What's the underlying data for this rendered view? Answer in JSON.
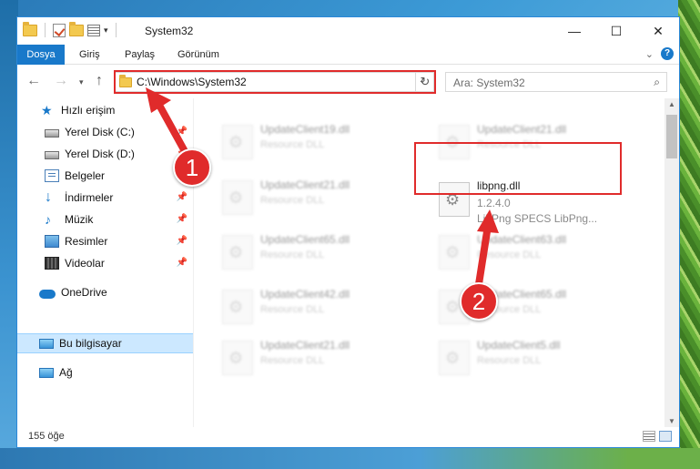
{
  "window": {
    "title": "System32"
  },
  "ribbon": {
    "tabs": [
      "Dosya",
      "Giriş",
      "Paylaş",
      "Görünüm"
    ],
    "help_icon": "?"
  },
  "caption": {
    "minimize": "—",
    "maximize": "☐",
    "close": "✕"
  },
  "navigation": {
    "back": "←",
    "forward": "→",
    "recent": "▾",
    "up": "↑",
    "address": "C:\\Windows\\System32",
    "refresh": "↻",
    "search_placeholder": "Ara: System32",
    "search_icon": "⌕"
  },
  "sidebar": {
    "items": [
      {
        "label": "Hızlı erişim",
        "icon": "star-icon"
      },
      {
        "label": "Yerel Disk (C:)",
        "icon": "disk-icon",
        "pinned": true
      },
      {
        "label": "Yerel Disk (D:)",
        "icon": "disk-icon",
        "pinned": true
      },
      {
        "label": "Belgeler",
        "icon": "documents-icon",
        "pinned": true
      },
      {
        "label": "İndirmeler",
        "icon": "download-icon",
        "pinned": true
      },
      {
        "label": "Müzik",
        "icon": "music-icon",
        "pinned": true
      },
      {
        "label": "Resimler",
        "icon": "pictures-icon",
        "pinned": true
      },
      {
        "label": "Videolar",
        "icon": "videos-icon",
        "pinned": true
      },
      {
        "label": "OneDrive",
        "icon": "cloud-icon"
      },
      {
        "label": "Bu bilgisayar",
        "icon": "computer-icon",
        "selected": true
      },
      {
        "label": "Ağ",
        "icon": "network-icon"
      }
    ],
    "pin_glyph": "📌"
  },
  "files": {
    "left": [
      {
        "name": "UpdateClient19.dll",
        "type": "Resource DLL"
      },
      {
        "name": "UpdateClient21.dll",
        "type": "Resource DLL"
      },
      {
        "name": "UpdateClient65.dll",
        "type": "Resource DLL"
      },
      {
        "name": "UpdateClient42.dll",
        "type": "Resource DLL"
      },
      {
        "name": "UpdateClient21.dll",
        "type": "Resource DLL"
      }
    ],
    "right": [
      {
        "name": "UpdateClient21.dll",
        "type": "Resource DLL"
      },
      {
        "name": "UpdateClient63.dll",
        "type": "Resource DLL"
      },
      {
        "name": "UpdateClient65.dll",
        "type": "Resource DLL"
      },
      {
        "name": "UpdateClient5.dll",
        "type": "Resource DLL"
      }
    ],
    "focused": {
      "name": "libpng.dll",
      "version": "1.2.4.0",
      "description": "LibPng SPECS LibPng..."
    }
  },
  "status": {
    "item_count": "155 öğe"
  },
  "callouts": {
    "step1": "1",
    "step2": "2"
  },
  "colors": {
    "accent": "#1979ca",
    "highlight": "#e02b2b"
  }
}
